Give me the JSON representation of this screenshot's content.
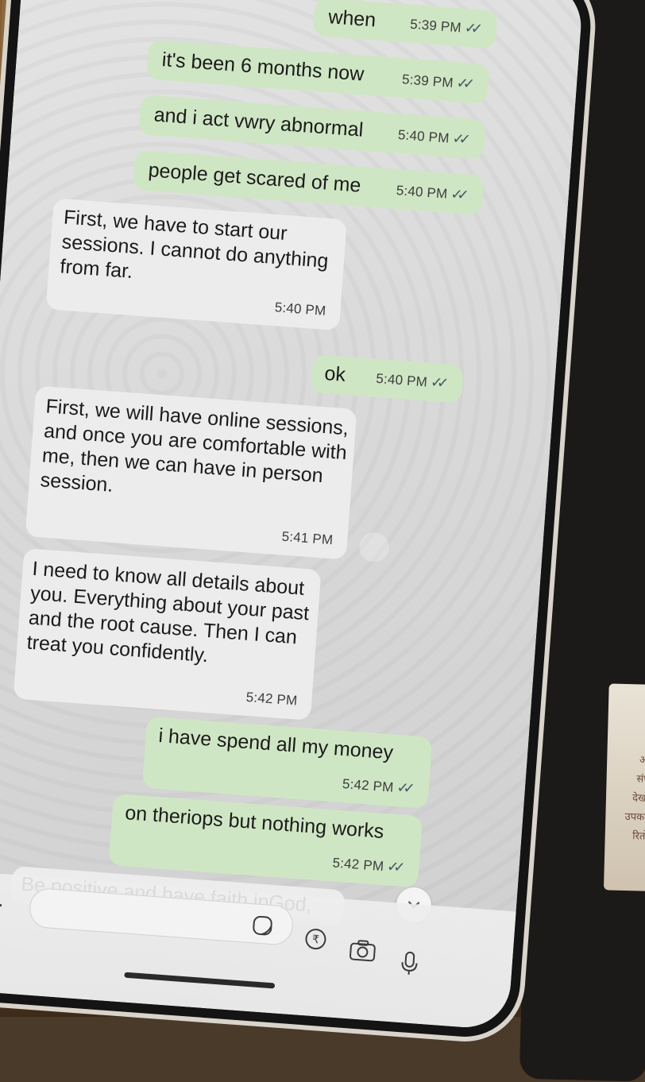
{
  "messages": [
    {
      "dir": "out",
      "text": "when",
      "time": "5:39 PM"
    },
    {
      "dir": "out",
      "text": "it's been 6 months now",
      "time": "5:39 PM"
    },
    {
      "dir": "out",
      "text": "and i act vwry abnormal",
      "time": "5:40 PM"
    },
    {
      "dir": "out",
      "text": "people get scared of me",
      "time": "5:40 PM"
    },
    {
      "dir": "in",
      "text": "First, we have to start our\nsessions. I cannot do anything\nfrom far.",
      "time": "5:40 PM"
    },
    {
      "dir": "out",
      "text": "ok",
      "time": "5:40 PM"
    },
    {
      "dir": "in",
      "text": "First, we will have online sessions,\nand once you are comfortable with\nme, then we can have in person\nsession.",
      "time": "5:41 PM"
    },
    {
      "dir": "in",
      "text": "I need to know all details about\nyou. Everything about your past\nand the root cause. Then I can\ntreat you confidently.",
      "time": "5:42 PM"
    },
    {
      "dir": "out",
      "text": "i have spend all my money",
      "time": "5:42 PM"
    },
    {
      "dir": "out",
      "text": "on theriops but nothing works",
      "time": "5:42 PM"
    },
    {
      "dir": "in",
      "text": "Be positive and have faith inGod,",
      "time": ""
    }
  ],
  "read_receipt": "✓✓",
  "composer": {
    "plus_icon": "plus-icon",
    "input_placeholder": "",
    "sticker_icon": "sticker-icon",
    "payment_icon": "rupee-payment-icon",
    "camera_icon": "camera-icon",
    "mic_icon": "microphone-icon"
  },
  "scroll_down_icon": "chevron-down-icon",
  "background_phone_text": "(\nओं\nसंप\nदेखो\nउपकर\nरितो"
}
